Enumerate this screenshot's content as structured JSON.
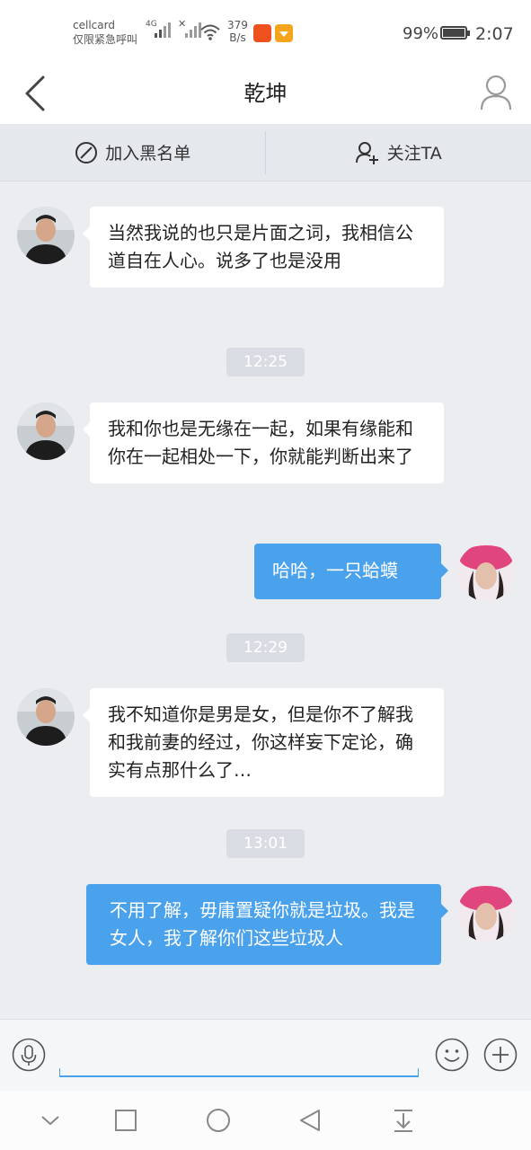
{
  "status_bar": {
    "carrier": "cellcard",
    "carrier_note": "仅限紧急呼叫",
    "network_type": "4G",
    "speed_value": "379",
    "speed_unit": "B/s",
    "battery": "99%",
    "time": "2:07"
  },
  "header": {
    "title": "乾坤",
    "back_icon": "chevron-left-icon",
    "profile_icon": "person-icon"
  },
  "actions": {
    "blacklist_label": "加入黑名单",
    "follow_label": "关注TA"
  },
  "messages": [
    {
      "type": "in",
      "text": "当然我说的也只是片面之词，我相信公道自在人心。说多了也是没用"
    },
    {
      "type": "time",
      "text": "12:25"
    },
    {
      "type": "in",
      "text": "我和你也是无缘在一起，如果有缘能和你在一起相处一下，你就能判断出来了"
    },
    {
      "type": "out",
      "text": "哈哈，一只蛤蟆"
    },
    {
      "type": "time",
      "text": "12:29"
    },
    {
      "type": "in",
      "text": "我不知道你是男是女，但是你不了解我和我前妻的经过，你这样妄下定论，确实有点那什么了…"
    },
    {
      "type": "time",
      "text": "13:01"
    },
    {
      "type": "out",
      "text": "不用了解，毋庸置疑你就是垃圾。我是女人，我了解你们这些垃圾人"
    }
  ],
  "input": {
    "value": "",
    "placeholder": ""
  },
  "colors": {
    "outgoing_bubble": "#4aa1ec",
    "incoming_bubble": "#ffffff",
    "chat_background": "#ebedf1",
    "timestamp_pill": "#d9dde3"
  }
}
